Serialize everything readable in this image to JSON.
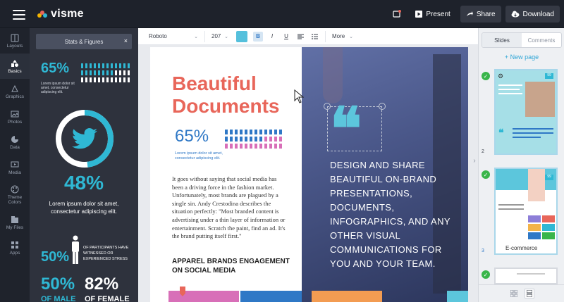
{
  "app": {
    "brand": "visme"
  },
  "topbar": {
    "present_label": "Present",
    "share_label": "Share",
    "download_label": "Download"
  },
  "rail": {
    "items": [
      {
        "label": "Layouts",
        "icon": "layouts-icon"
      },
      {
        "label": "Basics",
        "icon": "basics-icon"
      },
      {
        "label": "Graphics",
        "icon": "graphics-icon"
      },
      {
        "label": "Photos",
        "icon": "photos-icon"
      },
      {
        "label": "Data",
        "icon": "data-icon"
      },
      {
        "label": "Media",
        "icon": "media-icon"
      },
      {
        "label": "Theme Colors",
        "icon": "palette-icon"
      },
      {
        "label": "My Files",
        "icon": "files-icon"
      },
      {
        "label": "Apps",
        "icon": "apps-icon"
      }
    ]
  },
  "panel": {
    "tab_label": "Stats & Figures",
    "close_glyph": "×",
    "stat1_value": "65%",
    "stat1_text": "Lorem ipsum dolor sit amet, consectetur adipiscing elit.",
    "stat2_value": "48%",
    "stat2_text": "Lorem ipsum dolor sit amet, consectetur adipiscing elit.",
    "stat3_value": "50%",
    "stat3_text": "OF PARTICIPANTS HAVE WITNESSED OR EXPERIENCED STRESS",
    "stat4_value": "50%",
    "stat4_label": "OF MALE",
    "stat5_value": "82%",
    "stat5_label": "OF FEMALE"
  },
  "toolbar": {
    "font": "Roboto",
    "size": "207",
    "bold": "B",
    "italic": "I",
    "underline": "U",
    "more_label": "More"
  },
  "document": {
    "title_line1": "Beautiful",
    "title_line2": "Documents",
    "stat_value": "65%",
    "stat_text": "Lorem ipsum dolor sit amet, consectetur adipiscing elit.",
    "body": "It goes without saying that social media has been a driving force in the fashion market. Unfortunately, most brands are plagued by a single sin. Andy Crestodina describes the situation perfectly: \"Most branded content is advertising under a thin layer of information or entertainment. Scratch the paint, find an ad. It's the brand putting itself first.\"",
    "subheading": "APPAREL BRANDS ENGAGEMENT ON SOCIAL MEDIA",
    "quote_mark": "❝",
    "tagline": "DESIGN AND SHARE BEAUTIFUL ON-BRAND PRESENTATIONS, DOCUMENTS, INFOGRAPHICS, AND ANY OTHER VISUAL COMMUNICATIONS FOR YOU AND YOUR TEAM."
  },
  "slides": {
    "tab_slides": "Slides",
    "tab_comments": "Comments",
    "new_page": "+ New page",
    "thumb1_num": "2",
    "thumb1_badge": "99",
    "thumb2_num": "3",
    "thumb2_badge": "99",
    "thumb2_label": "E-commerce"
  },
  "colors": {
    "accent": "#2fb8d4",
    "title_red": "#e8665a",
    "check_green": "#39b54a",
    "doc_blue": "#3d4a7b"
  }
}
